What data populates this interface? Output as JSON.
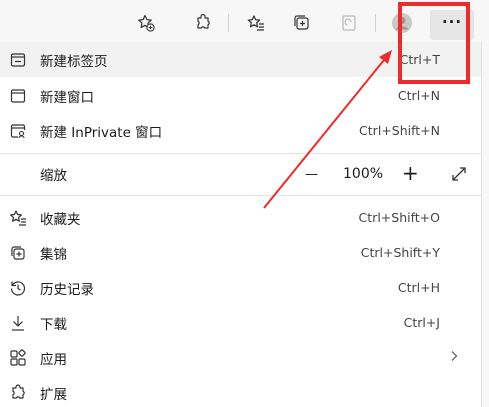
{
  "menu": {
    "items": [
      {
        "label": "新建标签页",
        "shortcut": "Ctrl+T"
      },
      {
        "label": "新建窗口",
        "shortcut": "Ctrl+N"
      },
      {
        "label": "新建 InPrivate 窗口",
        "shortcut": "Ctrl+Shift+N"
      },
      {
        "label": "收藏夹",
        "shortcut": "Ctrl+Shift+O"
      },
      {
        "label": "集锦",
        "shortcut": "Ctrl+Shift+Y"
      },
      {
        "label": "历史记录",
        "shortcut": "Ctrl+H"
      },
      {
        "label": "下载",
        "shortcut": "Ctrl+J"
      },
      {
        "label": "应用",
        "shortcut": ""
      },
      {
        "label": "扩展",
        "shortcut": ""
      }
    ],
    "zoom": {
      "label": "缩放",
      "minus": "—",
      "value": "100%",
      "plus": "+"
    }
  },
  "toolbar": {
    "more_label": "···"
  },
  "colors": {
    "annotation": "#ee2b2b",
    "menu_bg": "#ffffff",
    "toolbar_bg": "#f7f7f7"
  }
}
